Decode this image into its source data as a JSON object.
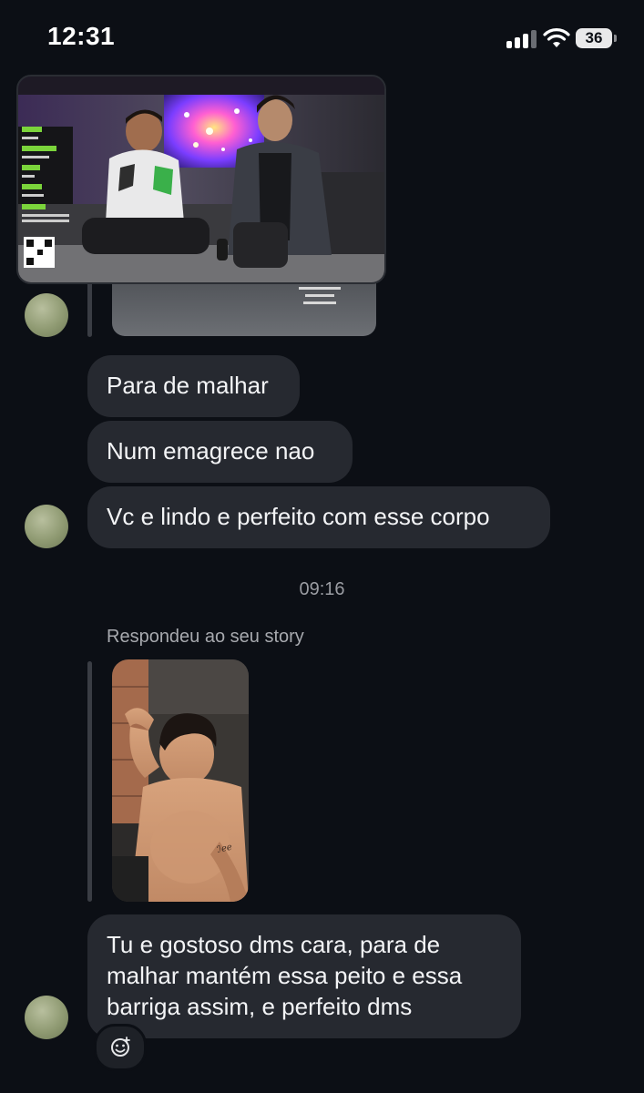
{
  "status_bar": {
    "time": "12:31",
    "battery": "36"
  },
  "messages": [
    {
      "text": "Para de malhar"
    },
    {
      "text": "Num emagrece nao"
    },
    {
      "text": "Vc e lindo e perfeito com esse corpo"
    }
  ],
  "timestamp": "09:16",
  "story_reply": {
    "label": "Respondeu ao seu story",
    "message": "Tu e gostoso dms cara, para de malhar mantém essa peito e essa barriga assim, e perfeito dms"
  },
  "icons": {
    "reaction": "emoji-add-icon",
    "signal": "cellular-signal-icon",
    "wifi": "wifi-icon",
    "battery": "battery-icon"
  },
  "colors": {
    "background": "#0c0f15",
    "bubble": "#262930",
    "text": "#f3f4f6",
    "muted": "#9a9ca2"
  }
}
